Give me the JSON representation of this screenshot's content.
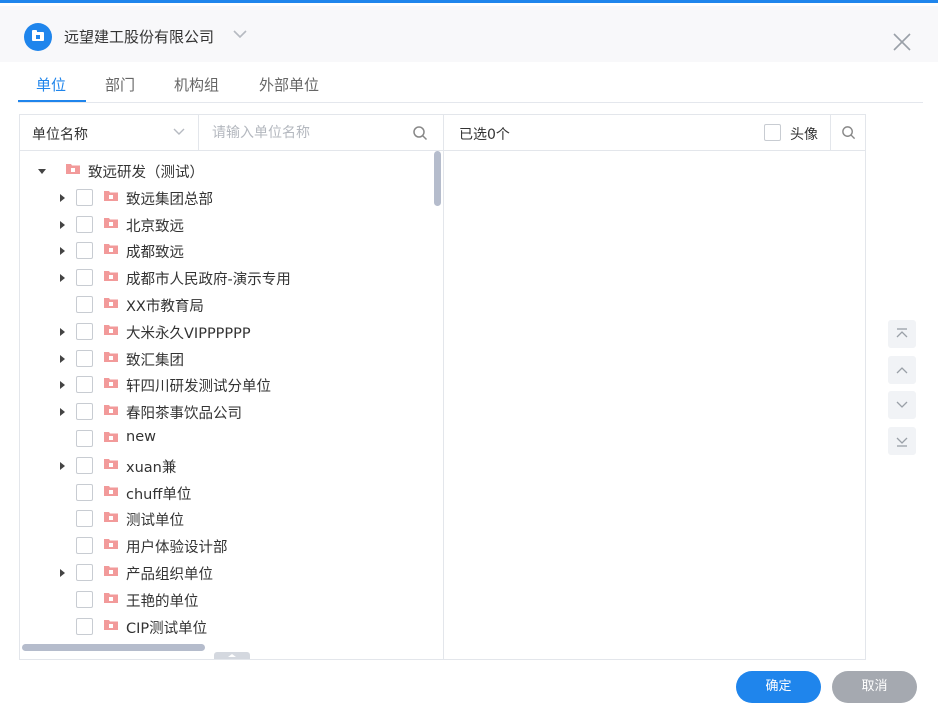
{
  "header": {
    "org_name": "远望建工股份有限公司"
  },
  "tabs": [
    {
      "label": "单位",
      "active": true
    },
    {
      "label": "部门",
      "active": false
    },
    {
      "label": "机构组",
      "active": false
    },
    {
      "label": "外部单位",
      "active": false
    }
  ],
  "left": {
    "type_select": "单位名称",
    "search_placeholder": "请输入单位名称",
    "tree": [
      {
        "label": "致远研发（测试）",
        "level": 0,
        "arrow": "expanded",
        "checkbox": false
      },
      {
        "label": "致远集团总部",
        "level": 1,
        "arrow": "collapsed",
        "checkbox": true
      },
      {
        "label": "北京致远",
        "level": 1,
        "arrow": "collapsed",
        "checkbox": true
      },
      {
        "label": "成都致远",
        "level": 1,
        "arrow": "collapsed",
        "checkbox": true
      },
      {
        "label": "成都市人民政府-演示专用",
        "level": 1,
        "arrow": "collapsed",
        "checkbox": true
      },
      {
        "label": "XX市教育局",
        "level": 1,
        "arrow": "none",
        "checkbox": true
      },
      {
        "label": "大米永久VIPPPPPP",
        "level": 1,
        "arrow": "collapsed",
        "checkbox": true
      },
      {
        "label": "致汇集团",
        "level": 1,
        "arrow": "collapsed",
        "checkbox": true
      },
      {
        "label": "轩四川研发测试分单位",
        "level": 1,
        "arrow": "collapsed",
        "checkbox": true
      },
      {
        "label": "春阳茶事饮品公司",
        "level": 1,
        "arrow": "collapsed",
        "checkbox": true
      },
      {
        "label": "new",
        "level": 1,
        "arrow": "none",
        "checkbox": true
      },
      {
        "label": "xuan兼",
        "level": 1,
        "arrow": "collapsed",
        "checkbox": true
      },
      {
        "label": "chuff单位",
        "level": 1,
        "arrow": "none",
        "checkbox": true
      },
      {
        "label": "测试单位",
        "level": 1,
        "arrow": "none",
        "checkbox": true
      },
      {
        "label": "用户体验设计部",
        "level": 1,
        "arrow": "none",
        "checkbox": true
      },
      {
        "label": "产品组织单位",
        "level": 1,
        "arrow": "collapsed",
        "checkbox": true
      },
      {
        "label": "王艳的单位",
        "level": 1,
        "arrow": "none",
        "checkbox": true
      },
      {
        "label": "CIP测试单位",
        "level": 1,
        "arrow": "none",
        "checkbox": true
      }
    ]
  },
  "right": {
    "selected_text": "已选0个",
    "avatar_label": "头像"
  },
  "buttons": {
    "ok": "确定",
    "cancel": "取消"
  },
  "colors": {
    "accent": "#1f85ec",
    "folder": "#f29a9a",
    "cancel": "#a5a9b0"
  }
}
